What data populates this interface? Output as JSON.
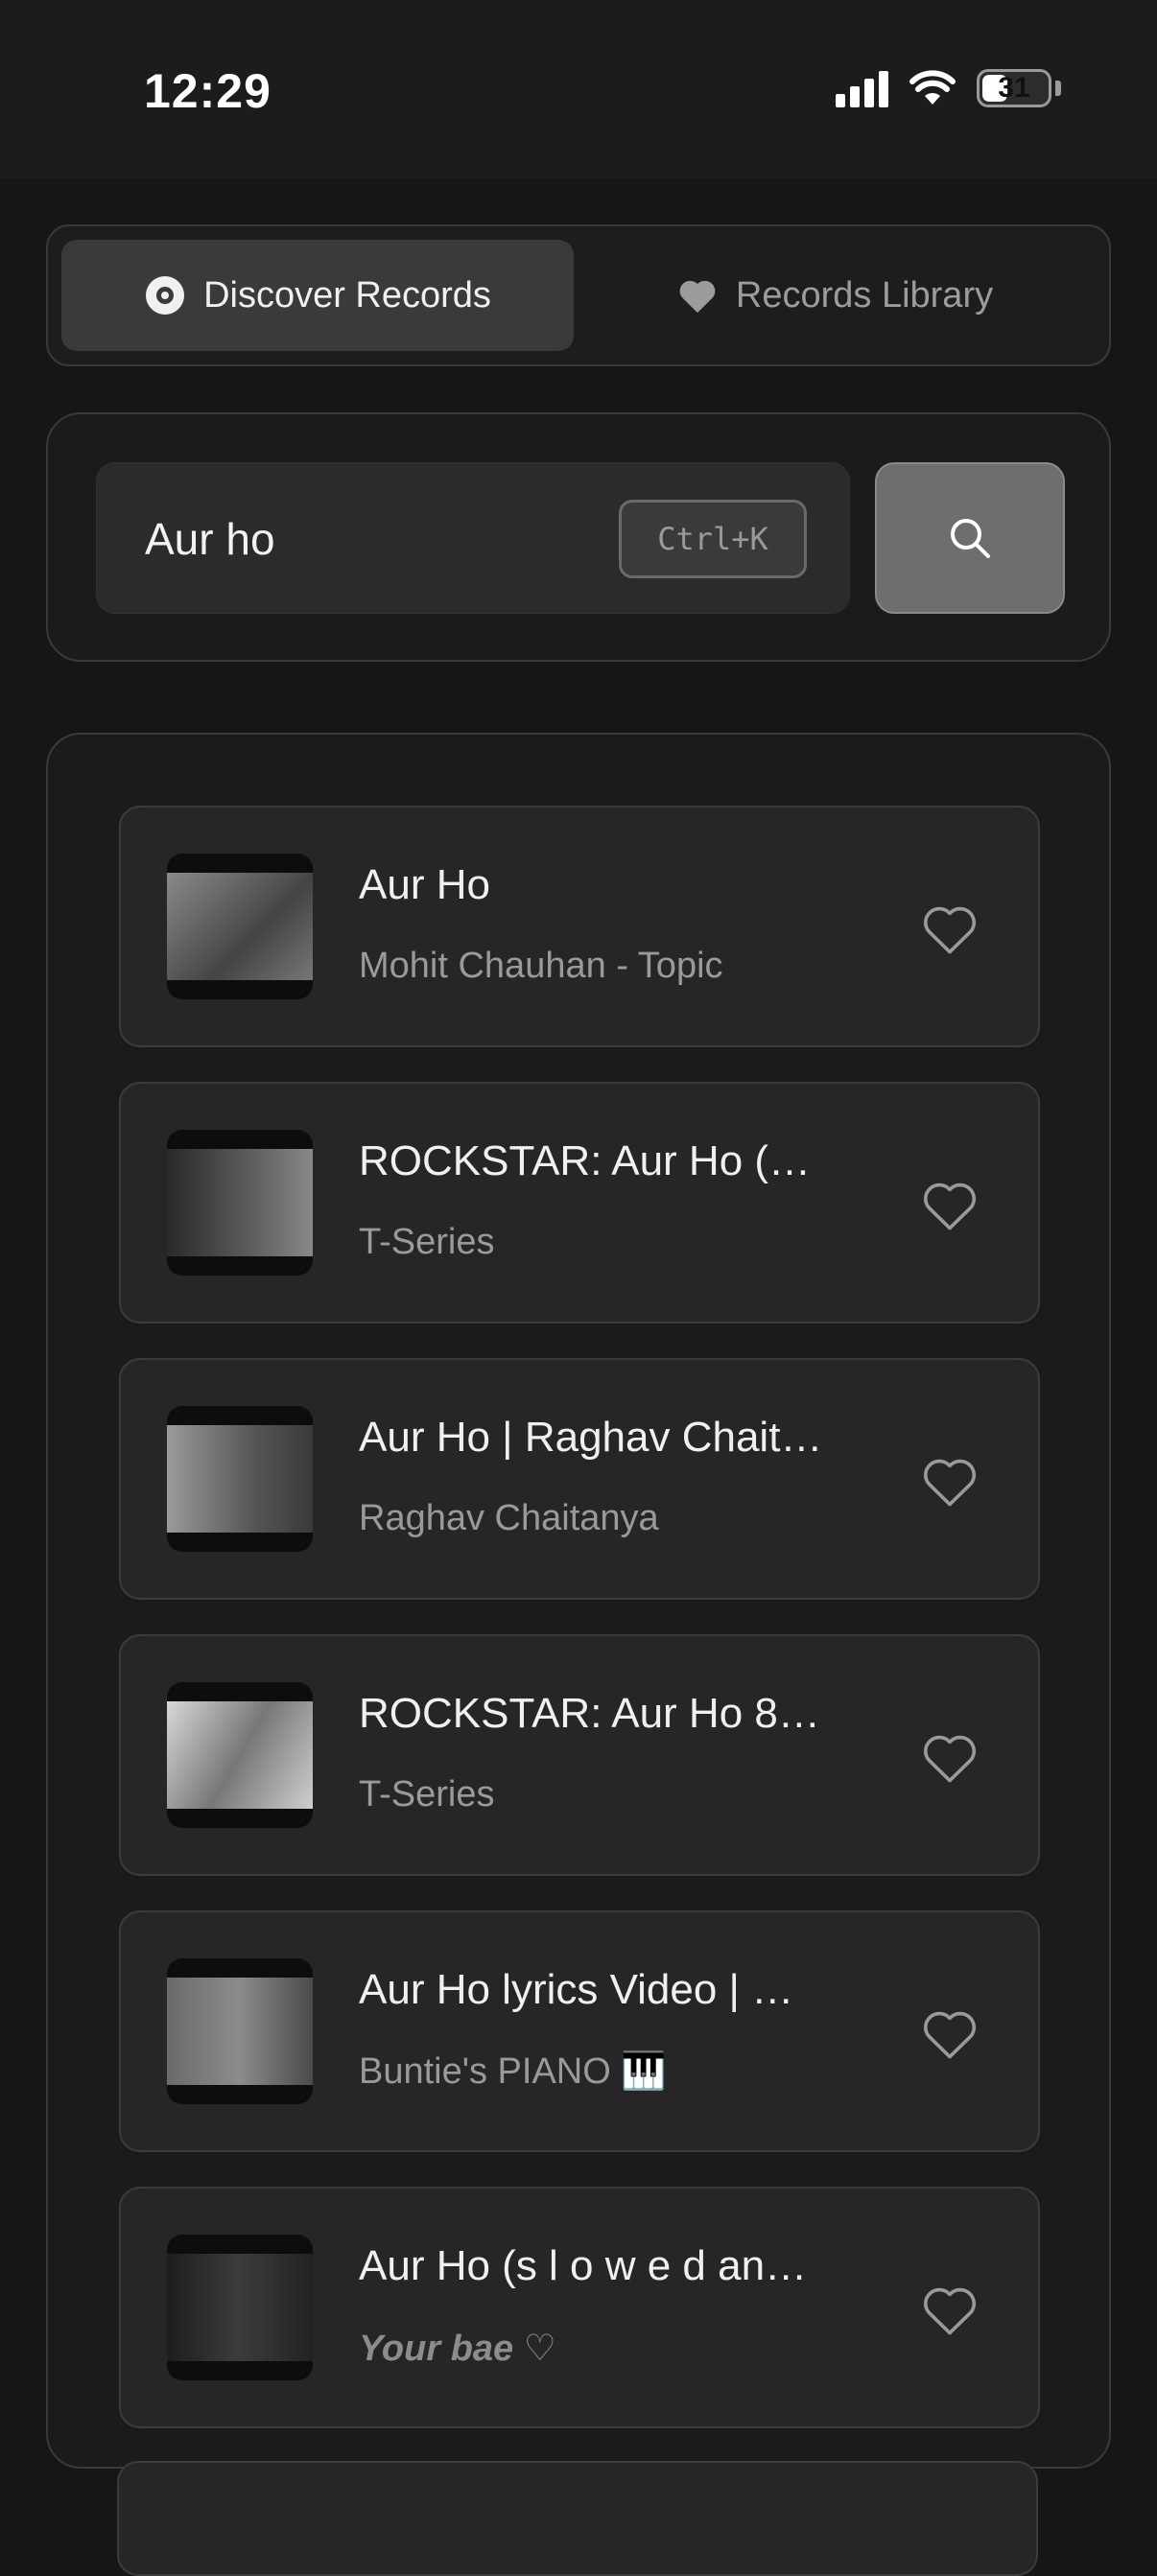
{
  "status_bar": {
    "time": "12:29",
    "battery": "31"
  },
  "tabs": [
    {
      "label": "Discover Records",
      "icon": "disc-icon",
      "active": true
    },
    {
      "label": "Records Library",
      "icon": "heart-filled-icon",
      "active": false
    }
  ],
  "search": {
    "value": "Aur ho",
    "shortcut": "Ctrl+K",
    "button_icon": "search-icon"
  },
  "results": [
    {
      "title": "Aur Ho",
      "artist": "Mohit Chauhan - Topic",
      "thumb_tone": "#6a6a6a"
    },
    {
      "title": "ROCKSTAR: Aur Ho (…",
      "artist": "T-Series",
      "thumb_tone": "#555555"
    },
    {
      "title": "Aur Ho | Raghav Chait…",
      "artist": "Raghav Chaitanya",
      "thumb_tone": "#707070"
    },
    {
      "title": "ROCKSTAR: Aur Ho 8…",
      "artist": "T-Series",
      "thumb_tone": "#8a8a8a"
    },
    {
      "title": "Aur Ho lyrics Video | …",
      "artist": "Buntie's PIANO 🎹",
      "thumb_tone": "#5e5e5e"
    },
    {
      "title": "Aur Ho (s l o w e d an…",
      "artist": "Your bae ♡",
      "thumb_tone": "#2e2e2e"
    }
  ]
}
